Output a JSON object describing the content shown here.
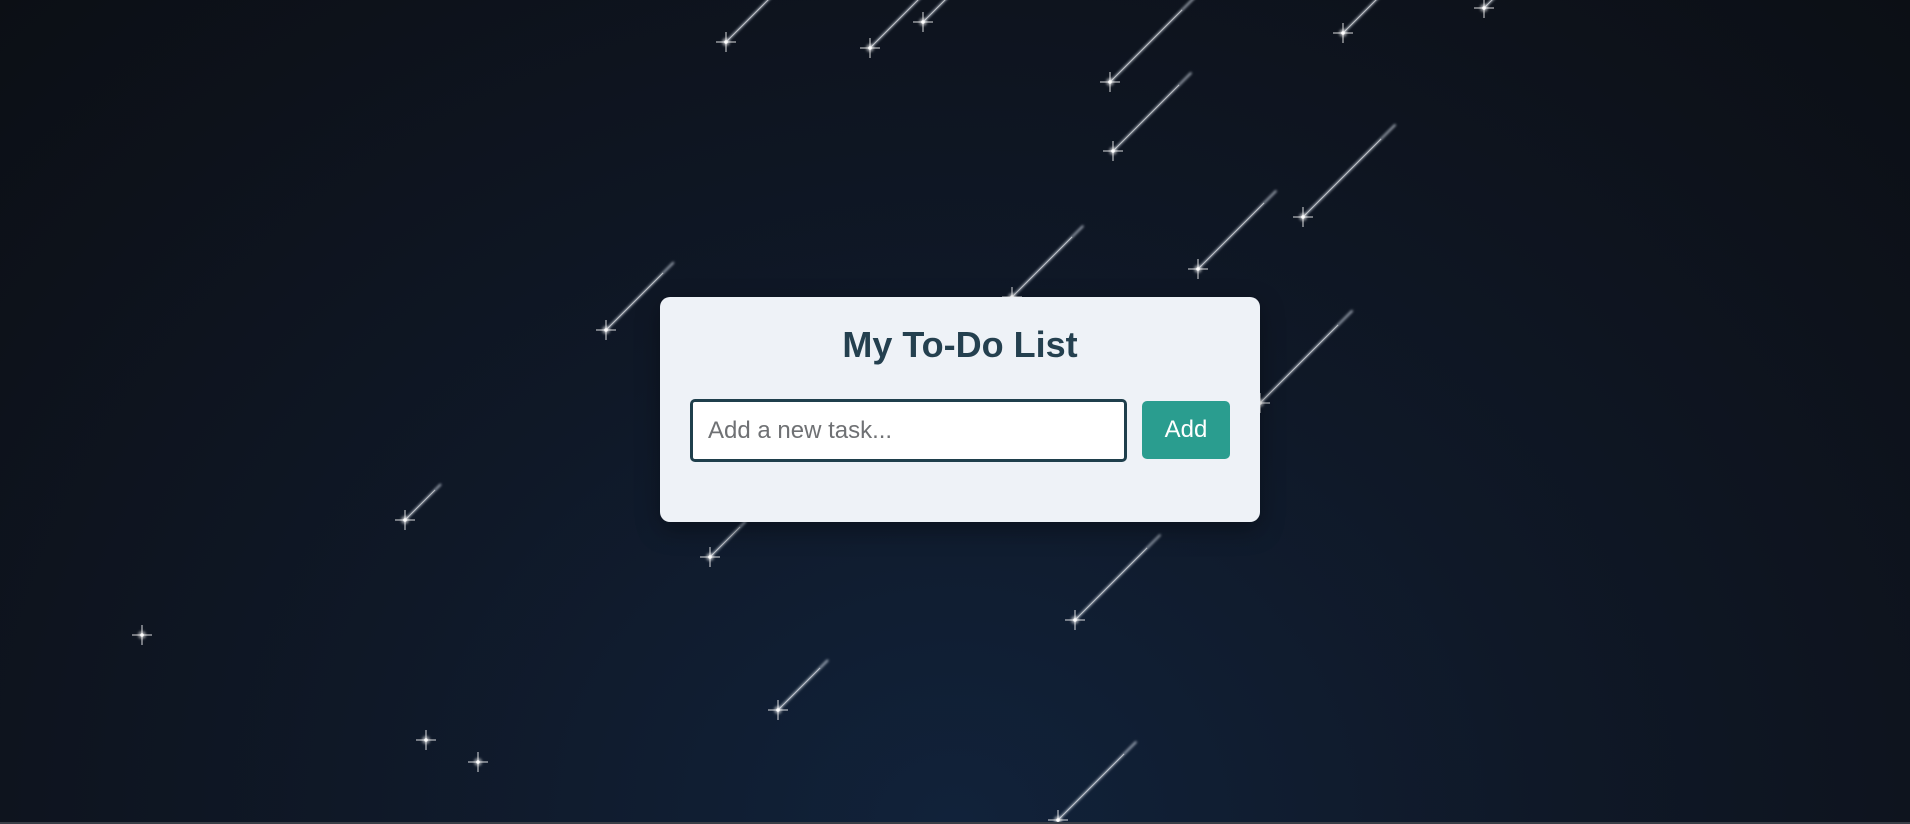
{
  "app": {
    "title": "My To-Do List"
  },
  "input": {
    "value": "",
    "placeholder": "Add a new task..."
  },
  "buttons": {
    "add_label": "Add"
  },
  "tasks": [],
  "colors": {
    "background": "#0f1827",
    "card": "#eef2f7",
    "title": "#24404f",
    "input_border": "#1f3f4c",
    "accent": "#2a9d8f",
    "star": "#ffffff"
  },
  "background_decoration": {
    "shooting_stars": "shooting-star-icon"
  }
}
